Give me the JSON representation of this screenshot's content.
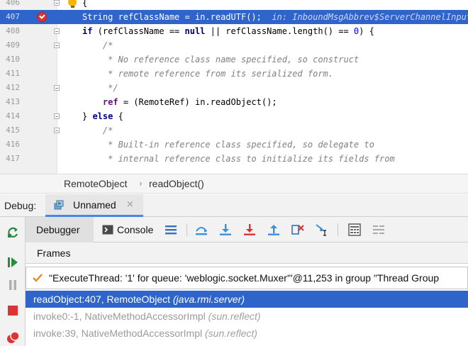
{
  "editor": {
    "lines": [
      {
        "num": "406",
        "segments": [
          {
            "t": "{",
            "c": ""
          }
        ]
      },
      {
        "num": "407",
        "current": true,
        "segments": [
          {
            "t": "String refClassName = in.readUTF();  ",
            "c": ""
          },
          {
            "t": "in: InboundMsgAbbrev$ServerChannelInputSt",
            "c": "inline-hint"
          }
        ]
      },
      {
        "num": "408",
        "segments": [
          {
            "t": "if",
            "c": "kw"
          },
          {
            "t": " (refClassName == ",
            "c": ""
          },
          {
            "t": "null",
            "c": "kw"
          },
          {
            "t": " || refClassName.length() == ",
            "c": ""
          },
          {
            "t": "0",
            "c": "num"
          },
          {
            "t": ") {",
            "c": ""
          }
        ]
      },
      {
        "num": "409",
        "segments": [
          {
            "t": "    /*",
            "c": "cm"
          }
        ]
      },
      {
        "num": "410",
        "segments": [
          {
            "t": "     * No reference class name specified, so construct",
            "c": "cm"
          }
        ]
      },
      {
        "num": "411",
        "segments": [
          {
            "t": "     * remote reference from its serialized form.",
            "c": "cm"
          }
        ]
      },
      {
        "num": "412",
        "segments": [
          {
            "t": "     */",
            "c": "cm"
          }
        ]
      },
      {
        "num": "413",
        "segments": [
          {
            "t": "    ",
            "c": ""
          },
          {
            "t": "ref",
            "c": "field"
          },
          {
            "t": " = (RemoteRef) in.readObject();",
            "c": ""
          }
        ]
      },
      {
        "num": "414",
        "segments": [
          {
            "t": "} ",
            "c": ""
          },
          {
            "t": "else",
            "c": "kw"
          },
          {
            "t": " {",
            "c": ""
          }
        ]
      },
      {
        "num": "415",
        "segments": [
          {
            "t": "    /*",
            "c": "cm"
          }
        ]
      },
      {
        "num": "416",
        "segments": [
          {
            "t": "     * Built-in reference class specified, so delegate to",
            "c": "cm"
          }
        ]
      },
      {
        "num": "417",
        "segments": [
          {
            "t": "     * internal reference class to initialize its fields from",
            "c": "cm"
          }
        ]
      }
    ]
  },
  "breadcrumb": {
    "items": [
      "RemoteObject",
      "readObject()"
    ],
    "separator": "›"
  },
  "debug": {
    "title": "Debug:",
    "session_tab": "Unnamed",
    "close_glyph": "×",
    "tabs": {
      "debugger": "Debugger",
      "console": "Console"
    },
    "frames_label": "Frames",
    "thread": "\"ExecuteThread: '1' for queue: 'weblogic.socket.Muxer'\"@11,253 in group \"Thread Group",
    "frames": [
      {
        "method": "readObject:407, RemoteObject",
        "pkg": "(java.rmi.server)",
        "selected": true
      },
      {
        "method": "invoke0:-1, NativeMethodAccessorImpl",
        "pkg": "(sun.reflect)",
        "selected": false
      },
      {
        "method": "invoke:39, NativeMethodAccessorImpl",
        "pkg": "(sun.reflect)",
        "selected": false
      }
    ]
  },
  "colors": {
    "selection": "#2f65ca",
    "keyword": "#000080",
    "comment": "#808080",
    "breakpoint": "#dd3333"
  },
  "icons": {
    "left_strip": [
      "rerun-icon",
      "resume-icon",
      "pause-icon",
      "stop-icon",
      "view-breakpoints-icon"
    ],
    "toolbar": [
      "layout-menu-icon",
      "show-execution-point-icon",
      "step-over-icon",
      "step-into-icon",
      "force-step-into-icon",
      "step-out-icon",
      "drop-frame-icon",
      "run-to-cursor-icon",
      "evaluate-expression-icon",
      "trace-icon"
    ]
  }
}
